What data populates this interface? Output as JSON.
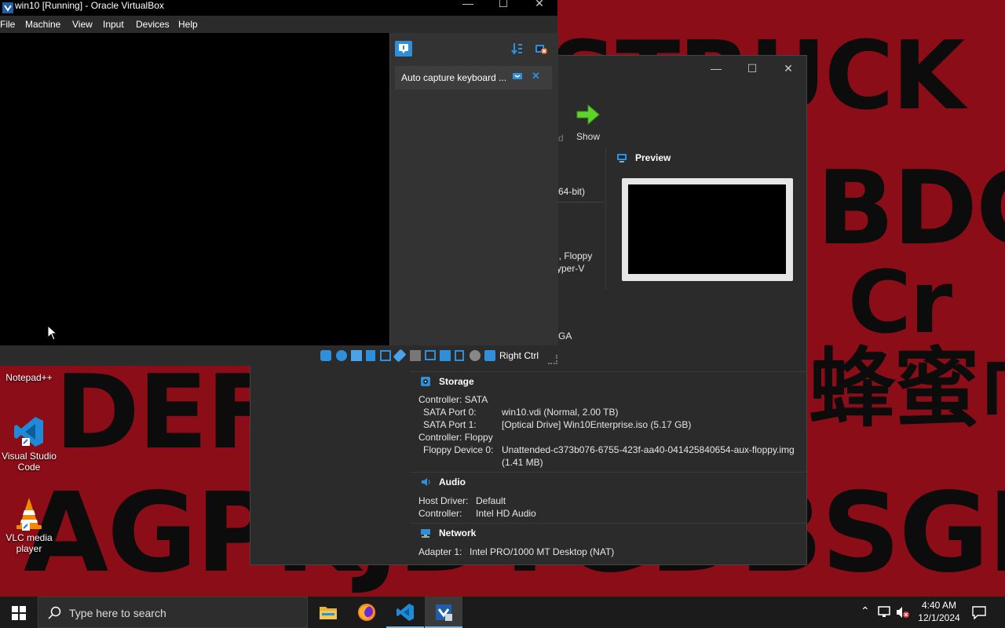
{
  "vm_window": {
    "title": "win10 [Running] - Oracle VirtualBox",
    "menu": [
      "File",
      "Machine",
      "View",
      "Input",
      "Devices",
      "Help"
    ],
    "notification": "Auto capture keyboard ...",
    "host_key": "Right Ctrl"
  },
  "manager": {
    "toolbar_show": "Show",
    "toolbar_partial_prev": "d",
    "general_partial": "64-bit)",
    "system_partial_1": "l, Floppy",
    "system_partial_2": "yper-V",
    "display_partial": "GA",
    "preview": {
      "title": "Preview"
    },
    "storage": {
      "title": "Storage",
      "controller_sata": "Controller: SATA",
      "port0_label": "SATA Port 0:",
      "port0_value": "win10.vdi (Normal, 2.00 TB)",
      "port1_label": "SATA Port 1:",
      "port1_value": "[Optical Drive] Win10Enterprise.iso (5.17 GB)",
      "controller_floppy": "Controller: Floppy",
      "floppy_label": "Floppy Device 0:",
      "floppy_value": "Unattended-c373b076-6755-423f-aa40-041425840654-aux-floppy.img",
      "floppy_size": "(1.41 MB)"
    },
    "audio": {
      "title": "Audio",
      "host_label": "Host Driver:",
      "host_value": "Default",
      "ctrl_label": "Controller:",
      "ctrl_value": "Intel HD Audio"
    },
    "network": {
      "title": "Network",
      "adapter_label": "Adapter 1:",
      "adapter_value": "Intel PRO/1000 MT Desktop (NAT)"
    }
  },
  "desktop": {
    "icons": [
      {
        "label": "Notepad++"
      },
      {
        "label": "Visual Studio Code"
      },
      {
        "label": "VLC media player"
      }
    ],
    "wallpaper_rows": [
      "STRUCK",
      "BDG",
      "Cr",
      "蜂蜜巾",
      "DEFAULT",
      "AGPKJDTGDBSGDFF"
    ]
  },
  "taskbar": {
    "search_placeholder": "Type here to search",
    "time": "4:40 AM",
    "date": "12/1/2024"
  },
  "colors": {
    "wallpaper_red": "#8b0d17",
    "window_dark": "#2b2b2b",
    "accent_blue": "#2f8fd8",
    "arrow_green": "#5fd32b"
  }
}
